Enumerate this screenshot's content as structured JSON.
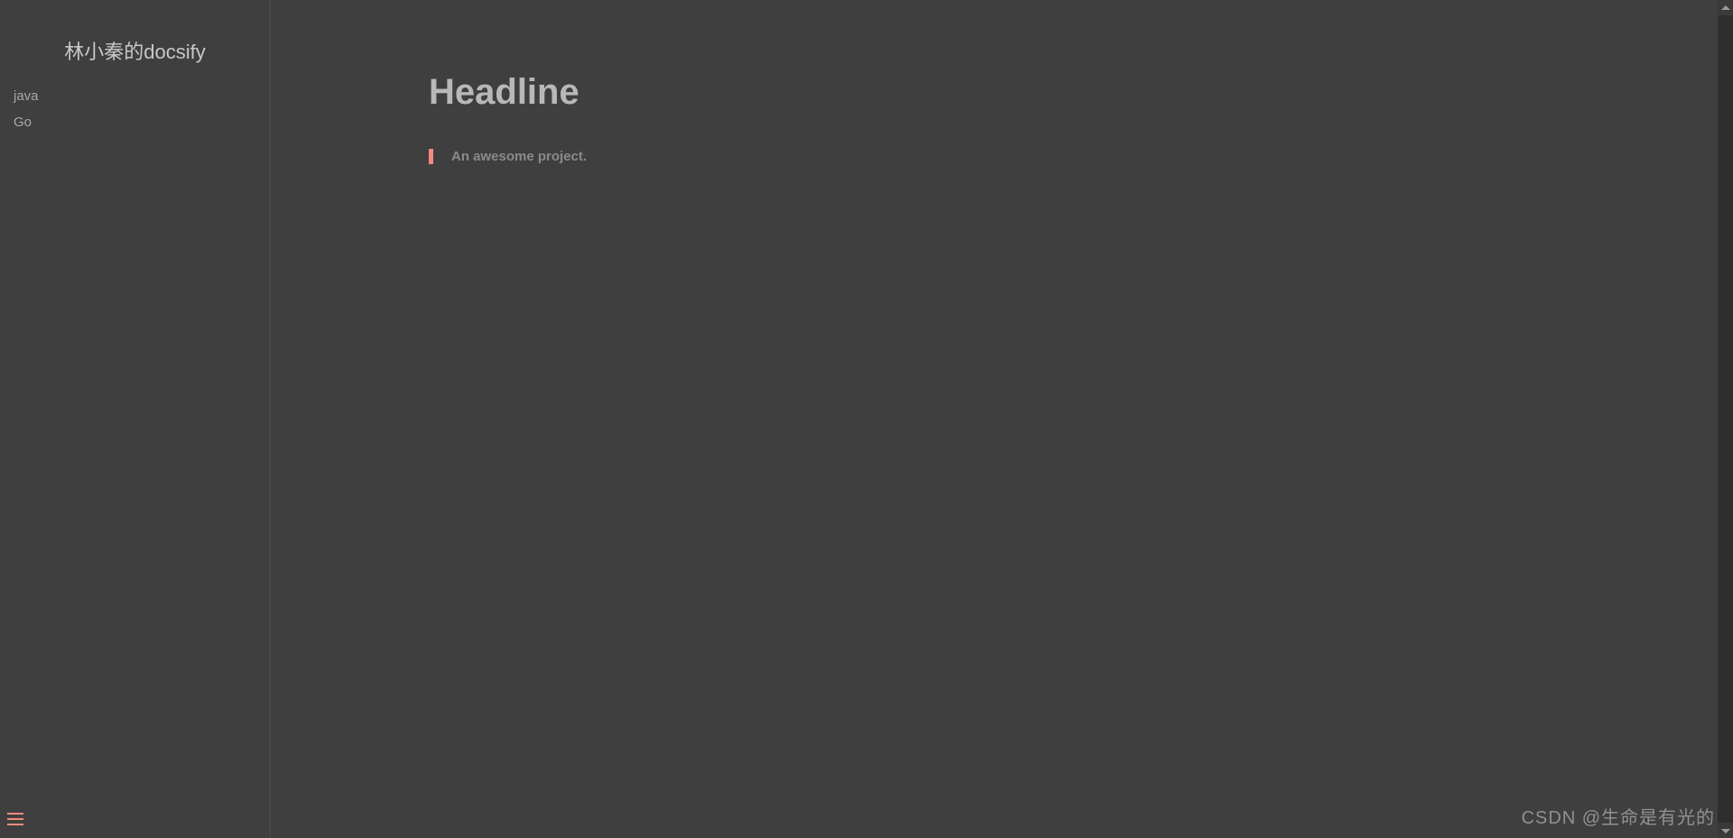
{
  "sidebar": {
    "title": "林小秦的docsify",
    "items": [
      {
        "label": "java"
      },
      {
        "label": "Go"
      }
    ]
  },
  "content": {
    "headline": "Headline",
    "blockquote": "An awesome project."
  },
  "watermark": "CSDN @生命是有光的",
  "colors": {
    "accent": "#f28b7e",
    "background": "#3f3f3f",
    "text": "#b4b4b4"
  }
}
